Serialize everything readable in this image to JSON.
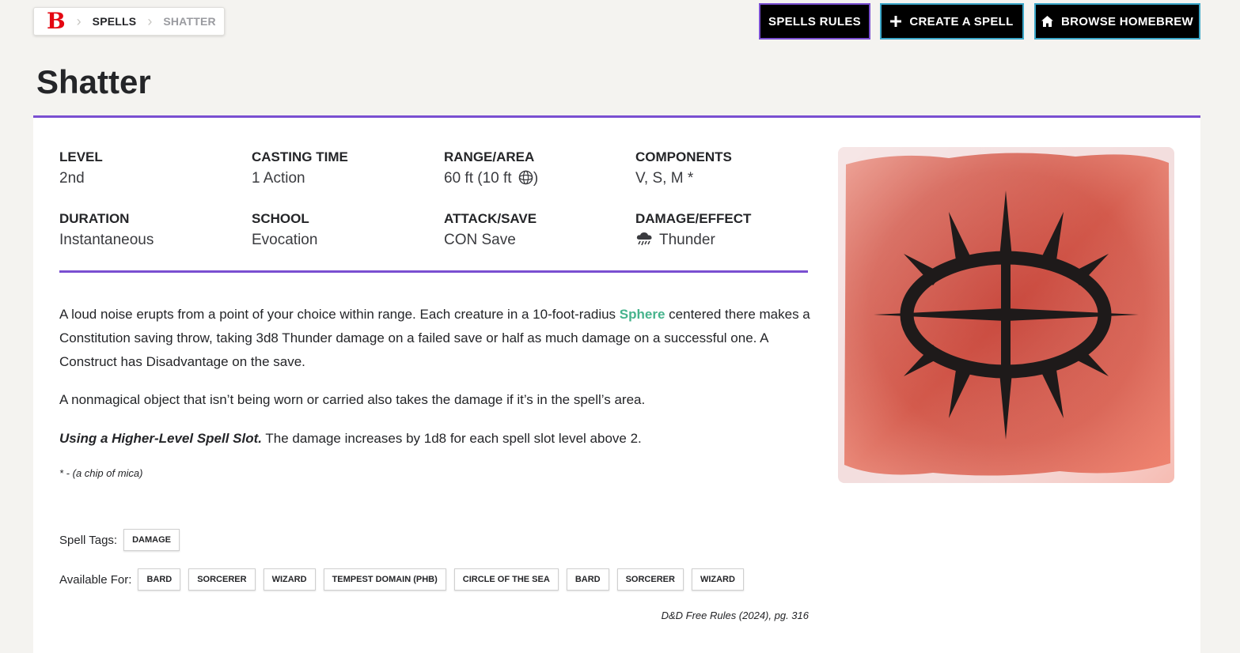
{
  "breadcrumb": {
    "logo": "B",
    "items": [
      "SPELLS",
      "SHATTER"
    ]
  },
  "top_buttons": {
    "rules": "SPELLS RULES",
    "create": "CREATE A SPELL",
    "browse": "BROWSE HOMEBREW"
  },
  "title": "Shatter",
  "stats": {
    "level_label": "LEVEL",
    "level": "2nd",
    "casting_label": "CASTING TIME",
    "casting": "1 Action",
    "range_label": "RANGE/AREA",
    "range": "60 ft (10 ft",
    "range_close": ")",
    "components_label": "COMPONENTS",
    "components": "V, S, M *",
    "duration_label": "DURATION",
    "duration": "Instantaneous",
    "school_label": "SCHOOL",
    "school": "Evocation",
    "attack_label": "ATTACK/SAVE",
    "attack": "CON Save",
    "damage_label": "DAMAGE/EFFECT",
    "damage": "Thunder"
  },
  "description": {
    "p1_before": "A loud noise erupts from a point of your choice within range. Each creature in a 10-foot-radius ",
    "p1_link": "Sphere",
    "p1_after": " centered there makes a Constitution saving throw, taking 3d8 Thunder damage on a failed save or half as much damage on a successful one. A Construct has Disadvantage on the save.",
    "p2": "A nonmagical object that isn’t being worn or carried also takes the damage if it’s in the spell’s area.",
    "p3_title": "Using a Higher-Level Spell Slot.",
    "p3_body": " The damage increases by 1d8 for each spell slot level above 2.",
    "footnote": "* - (a chip of mica)"
  },
  "spell_tags": {
    "label": "Spell Tags:",
    "tags": [
      "DAMAGE"
    ]
  },
  "available_for": {
    "label": "Available For:",
    "items": [
      "BARD",
      "SORCERER",
      "WIZARD",
      "TEMPEST DOMAIN (PHB)",
      "CIRCLE OF THE SEA",
      "BARD",
      "SORCERER",
      "WIZARD"
    ]
  },
  "source": "D&D Free Rules (2024), pg. 316",
  "colors": {
    "accent": "#7a4fd1",
    "brand": "#e40712",
    "link": "#46b38c",
    "button_border_blue": "#3ba7c9"
  },
  "icons": {
    "range_area": "sphere-icon",
    "damage_type": "thunder-cloud-icon",
    "create": "plus-icon",
    "browse": "home-icon",
    "art": "shatter-spell-symbol"
  }
}
